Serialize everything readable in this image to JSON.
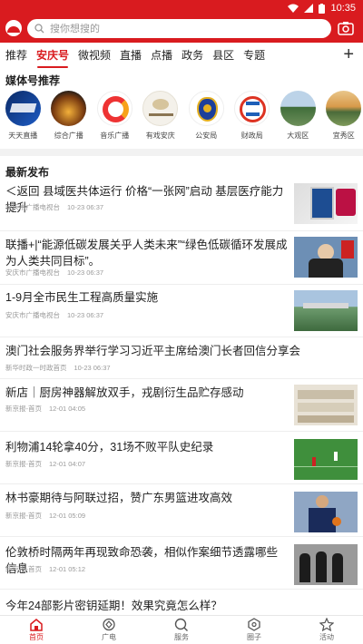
{
  "status": {
    "time": "10:35"
  },
  "search": {
    "placeholder": "搜你想搜的"
  },
  "tabs": [
    "推荐",
    "安庆号",
    "微视频",
    "直播",
    "点播",
    "政务",
    "县区",
    "专题"
  ],
  "active_tab": "安庆号",
  "media_section": {
    "title": "媒体号推荐"
  },
  "media": [
    {
      "label": "天天直播",
      "icon": "tiantian-live-logo"
    },
    {
      "label": "综合广播",
      "icon": "general-radio-logo"
    },
    {
      "label": "音乐广播",
      "icon": "music-radio-logo"
    },
    {
      "label": "有戏安庆",
      "icon": "opera-anqing-logo"
    },
    {
      "label": "公安局",
      "icon": "police-badge-logo"
    },
    {
      "label": "财政局",
      "icon": "finance-bureau-logo"
    },
    {
      "label": "大观区",
      "icon": "daguan-district-logo"
    },
    {
      "label": "宜秀区",
      "icon": "yixiu-district-logo"
    }
  ],
  "latest_section": {
    "title": "最新发布"
  },
  "news": [
    {
      "title": "＜返回 县域医共体运行 价格“一张网”启动 基层医疗能力提升",
      "source": "安庆市广播电视台",
      "time": "10-23 06:37"
    },
    {
      "title": "联播+|“能源低碳发展关乎人类未来”“绿色低碳循环发展成为人类共同目标”。",
      "source": "安庆市广播电视台",
      "time": "10-23 06:37"
    },
    {
      "title": "1-9月全市民生工程高质量实施",
      "source": "安庆市广播电视台",
      "time": "10-23 06:37"
    },
    {
      "title": "澳门社会服务界举行学习习近平主席给澳门长者回信分享会",
      "source": "新华时政一时政首页",
      "time": "10-23 06:37"
    },
    {
      "title": "新店｜厨房神器解放双手，戎剧衍生品贮存感动",
      "source": "新京报-首页",
      "time": "12-01 04:05"
    },
    {
      "title": "利物浦14轮拿40分，31场不败平队史纪录",
      "source": "新京报-首页",
      "time": "12-01 04:07"
    },
    {
      "title": "林书豪期待与阿联过招，赞广东男篮进攻高效",
      "source": "新京报-首页",
      "time": "12-01 05:09"
    },
    {
      "title": "伦敦桥时隔两年再现致命恐袭，相似作案细节透露哪些信息",
      "source": "新京报-首页",
      "time": "12-01 05:12"
    },
    {
      "title": "今年24部影片密钥延期！效果究竟怎么样？",
      "source": "",
      "time": ""
    }
  ],
  "bottom_nav": [
    {
      "label": "首页",
      "icon": "home-icon"
    },
    {
      "label": "广电",
      "icon": "tv-station-icon"
    },
    {
      "label": "服务",
      "icon": "service-icon"
    },
    {
      "label": "圈子",
      "icon": "circle-icon"
    },
    {
      "label": "活动",
      "icon": "star-icon"
    }
  ],
  "colors": {
    "brand": "#d91b1f",
    "meta": "#999999"
  }
}
